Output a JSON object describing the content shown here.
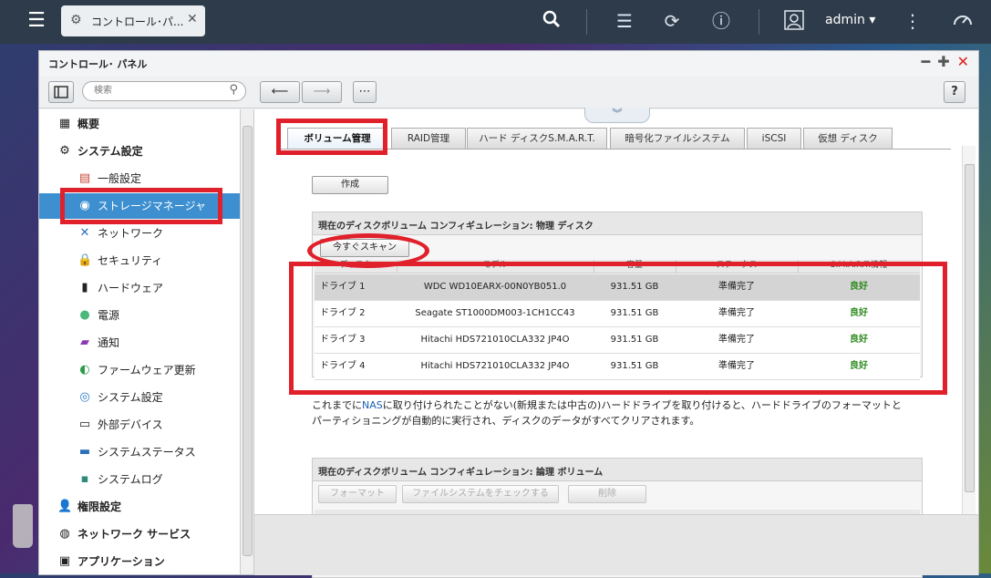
{
  "taskbar": {
    "tab_label": "コントロール･パ...",
    "user": "admin ▾"
  },
  "window": {
    "title": "コントロール･ パネル",
    "search_placeholder": "検索"
  },
  "sidebar": {
    "items": [
      {
        "label": "概要",
        "level": "top",
        "icon": "overview-icon"
      },
      {
        "label": "システム設定",
        "level": "top",
        "icon": "gear-icon"
      },
      {
        "label": "一般設定",
        "level": "sub",
        "icon": "general-settings-icon"
      },
      {
        "label": "ストレージマネージャ",
        "level": "sub",
        "icon": "storage-icon",
        "active": true
      },
      {
        "label": "ネットワーク",
        "level": "sub",
        "icon": "network-icon"
      },
      {
        "label": "セキュリティ",
        "level": "sub",
        "icon": "lock-icon"
      },
      {
        "label": "ハードウェア",
        "level": "sub",
        "icon": "hardware-icon"
      },
      {
        "label": "電源",
        "level": "sub",
        "icon": "power-icon"
      },
      {
        "label": "通知",
        "level": "sub",
        "icon": "notification-icon"
      },
      {
        "label": "ファームウェア更新",
        "level": "sub",
        "icon": "firmware-icon"
      },
      {
        "label": "システム設定",
        "level": "sub",
        "icon": "system-settings-icon"
      },
      {
        "label": "外部デバイス",
        "level": "sub",
        "icon": "external-device-icon"
      },
      {
        "label": "システムステータス",
        "level": "sub",
        "icon": "system-status-icon"
      },
      {
        "label": "システムログ",
        "level": "sub",
        "icon": "log-icon"
      },
      {
        "label": "権限設定",
        "level": "top",
        "icon": "user-icon"
      },
      {
        "label": "ネットワーク サービス",
        "level": "top",
        "icon": "globe-icon"
      },
      {
        "label": "アプリケーション",
        "level": "top",
        "icon": "app-icon"
      }
    ]
  },
  "tabs": [
    "ボリューム管理",
    "RAID管理",
    "ハード ディスクS.M.A.R.T.",
    "暗号化ファイルシステム",
    "iSCSI",
    "仮想 ディスク"
  ],
  "create_label": "作成",
  "physical": {
    "title": "現在のディスクボリューム コンフィギュレーション: 物理 ディスク",
    "scan_label": "今すぐスキャン",
    "headers": [
      "ディスク",
      "モデル",
      "容量",
      "ステータス",
      "S.M.A.R.T.情報"
    ],
    "rows": [
      {
        "disk": "ドライブ 1",
        "model": "WDC WD10EARX-00N0YB051.0",
        "capacity": "931.51 GB",
        "status": "準備完了",
        "smart": "良好"
      },
      {
        "disk": "ドライブ 2",
        "model": "Seagate ST1000DM003-1CH1CC43",
        "capacity": "931.51 GB",
        "status": "準備完了",
        "smart": "良好"
      },
      {
        "disk": "ドライブ 3",
        "model": "Hitachi HDS721010CLA332 JP4O",
        "capacity": "931.51 GB",
        "status": "準備完了",
        "smart": "良好"
      },
      {
        "disk": "ドライブ 4",
        "model": "Hitachi HDS721010CLA332 JP4O",
        "capacity": "931.51 GB",
        "status": "準備完了",
        "smart": "良好"
      }
    ]
  },
  "note": {
    "part1": "これまでに",
    "nas": "NAS",
    "part2": "に取り付けられたことがない(新規または中古の)ハードドライブを取り付けると、ハードドライブのフォーマットと",
    "line2": "パーティショニングが自動的に実行され、ディスクのデータがすべてクリアされます。"
  },
  "logical": {
    "title": "現在のディスクボリューム コンフィギュレーション: 論理 ボリューム",
    "buttons": [
      "フォーマット",
      "ファイルシステムをチェックする",
      "削除"
    ]
  }
}
